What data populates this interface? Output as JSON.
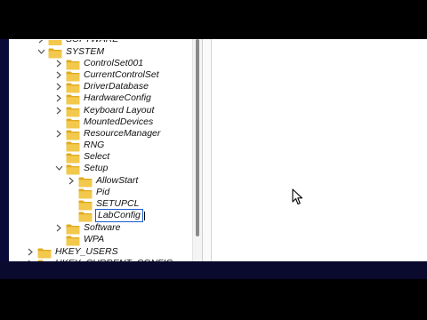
{
  "tree": {
    "items": [
      {
        "label": "SOFTWARE",
        "expanded": false,
        "editing": false
      },
      {
        "label": "SYSTEM",
        "expanded": true,
        "editing": false
      },
      {
        "label": "ControlSet001",
        "expanded": false,
        "editing": false
      },
      {
        "label": "CurrentControlSet",
        "expanded": false,
        "editing": false
      },
      {
        "label": "DriverDatabase",
        "expanded": false,
        "editing": false
      },
      {
        "label": "HardwareConfig",
        "expanded": false,
        "editing": false
      },
      {
        "label": "Keyboard Layout",
        "expanded": false,
        "editing": false
      },
      {
        "label": "MountedDevices",
        "expanded": false,
        "editing": false
      },
      {
        "label": "ResourceManager",
        "expanded": false,
        "editing": false
      },
      {
        "label": "RNG",
        "expanded": false,
        "editing": false
      },
      {
        "label": "Select",
        "expanded": false,
        "editing": false
      },
      {
        "label": "Setup",
        "expanded": true,
        "editing": false
      },
      {
        "label": "AllowStart",
        "expanded": false,
        "editing": false
      },
      {
        "label": "Pid",
        "expanded": false,
        "editing": false
      },
      {
        "label": "SETUPCL",
        "expanded": false,
        "editing": false
      },
      {
        "label": "LabConfig",
        "expanded": false,
        "editing": true
      },
      {
        "label": "Software",
        "expanded": false,
        "editing": false
      },
      {
        "label": "WPA",
        "expanded": false,
        "editing": false
      },
      {
        "label": "HKEY_USERS",
        "expanded": false,
        "editing": false
      },
      {
        "label": "HKEY_CURRENT_CONFIG",
        "expanded": false,
        "editing": false
      }
    ]
  },
  "colors": {
    "folder_fill": "#f2c94c",
    "folder_tab": "#e0a91e",
    "edit_border": "#1a5bd1",
    "footer": "#0a0a2e"
  },
  "icons": {
    "folder": "folder-icon",
    "expand": "chevron-right-icon",
    "collapse": "chevron-down-icon",
    "cursor": "mouse-pointer-icon"
  }
}
